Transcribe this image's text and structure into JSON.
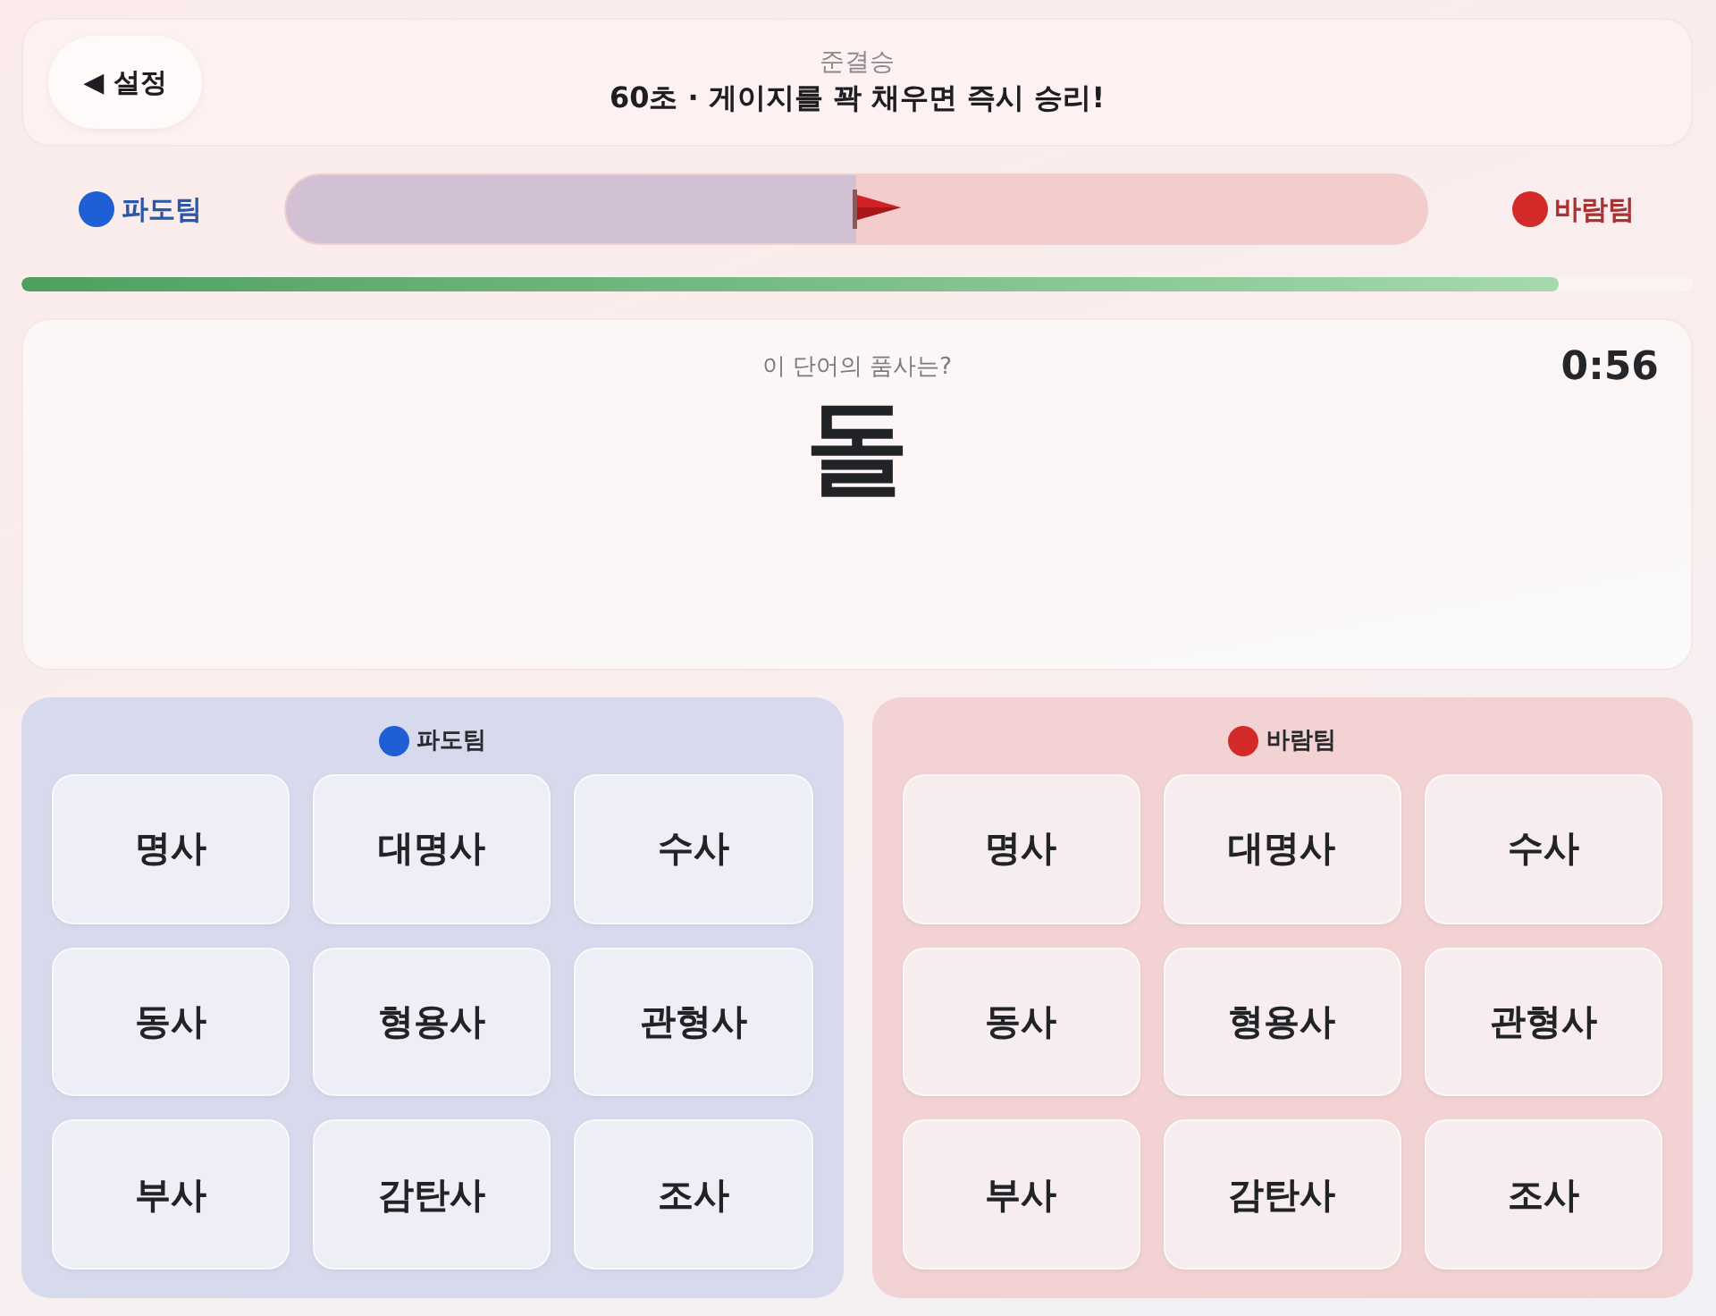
{
  "header": {
    "back_button": "◀ 설정",
    "round": "준결승",
    "rule": "60초 · 게이지를 꽉 채우면 즉시 승리!"
  },
  "tug": {
    "left_team": {
      "name": "파도팀",
      "color": "#1f5fd6"
    },
    "right_team": {
      "name": "바람팀",
      "color": "#d42a2a"
    },
    "level": 0.5
  },
  "timer_bar": {
    "level": 0.92
  },
  "question": {
    "prompt": "이 단어의 품사는?",
    "word": "돌",
    "time": "0:56"
  },
  "panels": [
    {
      "name": "파도팀",
      "color": "#1f5fd6",
      "options": [
        "명사",
        "대명사",
        "수사",
        "동사",
        "형용사",
        "관형사",
        "부사",
        "감탄사",
        "조사"
      ]
    },
    {
      "name": "바람팀",
      "color": "#d42a2a",
      "options": [
        "명사",
        "대명사",
        "수사",
        "동사",
        "형용사",
        "관형사",
        "부사",
        "감탄사",
        "조사"
      ]
    }
  ]
}
